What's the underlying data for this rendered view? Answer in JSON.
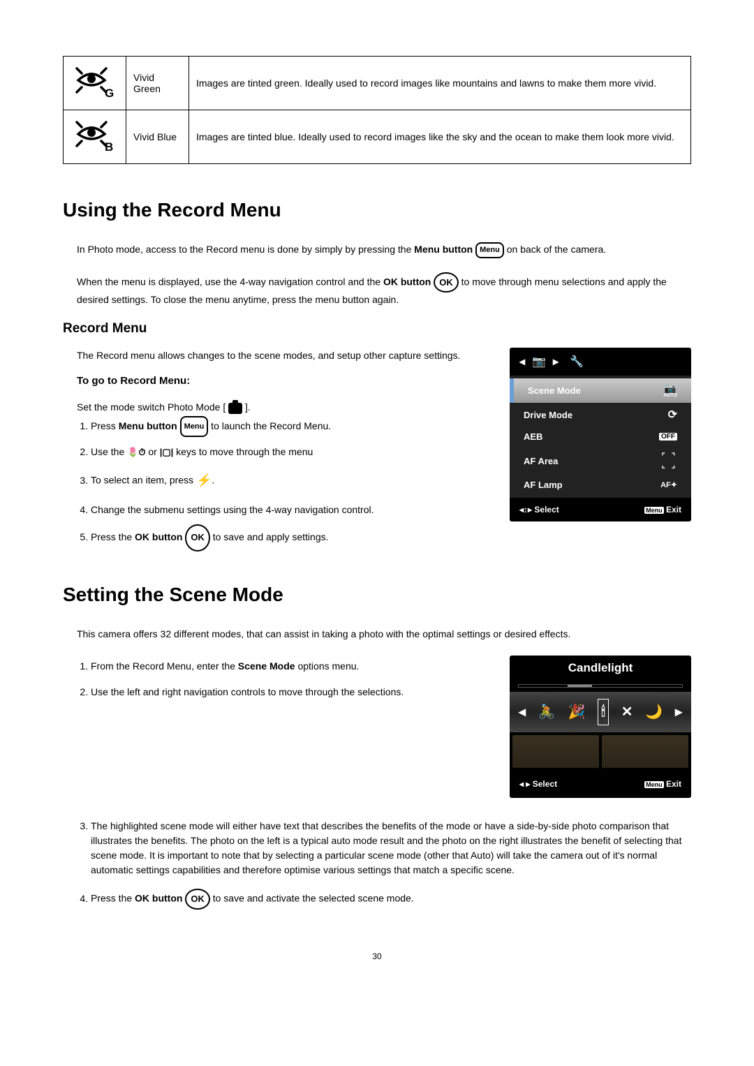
{
  "colorTable": {
    "row1": {
      "name": "Vivid Green",
      "iconSuffix": "G",
      "desc": "Images are tinted green. Ideally used to record images like mountains and lawns to make them more vivid."
    },
    "row2": {
      "name": "Vivid Blue",
      "iconSuffix": "B",
      "desc": "Images are tinted blue. Ideally used to record images like the sky and the ocean to make them look more vivid."
    }
  },
  "section1": {
    "heading": "Using the Record Menu",
    "p1a": "In Photo mode, access to the Record menu is done by simply by pressing the ",
    "p1b": "Menu button",
    "p1c": " on back of the camera.",
    "p2a": "When the menu is displayed, use the 4-way navigation control and the ",
    "p2b": "OK button",
    "p2c": " to move through menu selections and apply the desired settings. To close the menu anytime, press the menu button again.",
    "subHeading": "Record Menu",
    "subP1": "The Record menu allows changes to the scene modes, and setup other capture settings.",
    "subH3": "To go to Record Menu:",
    "setMode": "Set the mode switch Photo Mode [ ",
    "setModeEnd": " ].",
    "steps": {
      "s1a": "Press ",
      "s1b": "Menu button",
      "s1c": " to launch the Record Menu.",
      "s2": "Use the ",
      "s2b": " keys to move through the menu",
      "s3": "To select an item, press ",
      "s3end": ".",
      "s4": "Change the submenu settings using the 4-way navigation control.",
      "s5a": "Press the ",
      "s5b": "OK button",
      "s5c": " to save and apply settings."
    }
  },
  "recordScreen": {
    "row1": {
      "label": "Scene Mode",
      "iconTop": "📷",
      "iconBot": "AUTO"
    },
    "row2": {
      "label": "Drive Mode",
      "icon": "⚙"
    },
    "row3": {
      "label": "AEB",
      "icon": "OFF"
    },
    "row4": {
      "label": "AF Area",
      "icon": "[ ]"
    },
    "row5": {
      "label": "AF Lamp",
      "icon": "AF"
    },
    "footerSelect": "Select",
    "footerExit": "Exit",
    "footerMenu": "Menu"
  },
  "section2": {
    "heading": "Setting the Scene Mode",
    "p1": "This camera offers 32 different modes, that can assist in taking a photo with the optimal settings or desired effects.",
    "steps": {
      "s1a": "From the Record Menu, enter the ",
      "s1b": "Scene Mode",
      "s1c": " options menu.",
      "s2": "Use the left and right navigation controls to move through the selections.",
      "s3": "The highlighted scene mode will either have text that describes the benefits of the mode or have a side-by-side photo comparison that illustrates the benefits. The photo on the left is a typical auto mode result and the photo on the right illustrates the benefit of selecting that scene mode. It is important to note that by selecting a particular scene mode (other that Auto) will take the camera out of it's normal automatic settings capabilities and therefore optimise various settings that match a specific scene.",
      "s4a": "Press the ",
      "s4b": "OK button",
      "s4c": " to save and activate the selected scene mode."
    }
  },
  "sceneScreen": {
    "title": "Candlelight",
    "footerSelect": "Select",
    "footerExit": "Exit",
    "footerMenu": "Menu"
  },
  "icons": {
    "menuLabel": "Menu",
    "okLabel": "OK",
    "orText": " or "
  },
  "pageNumber": "30"
}
